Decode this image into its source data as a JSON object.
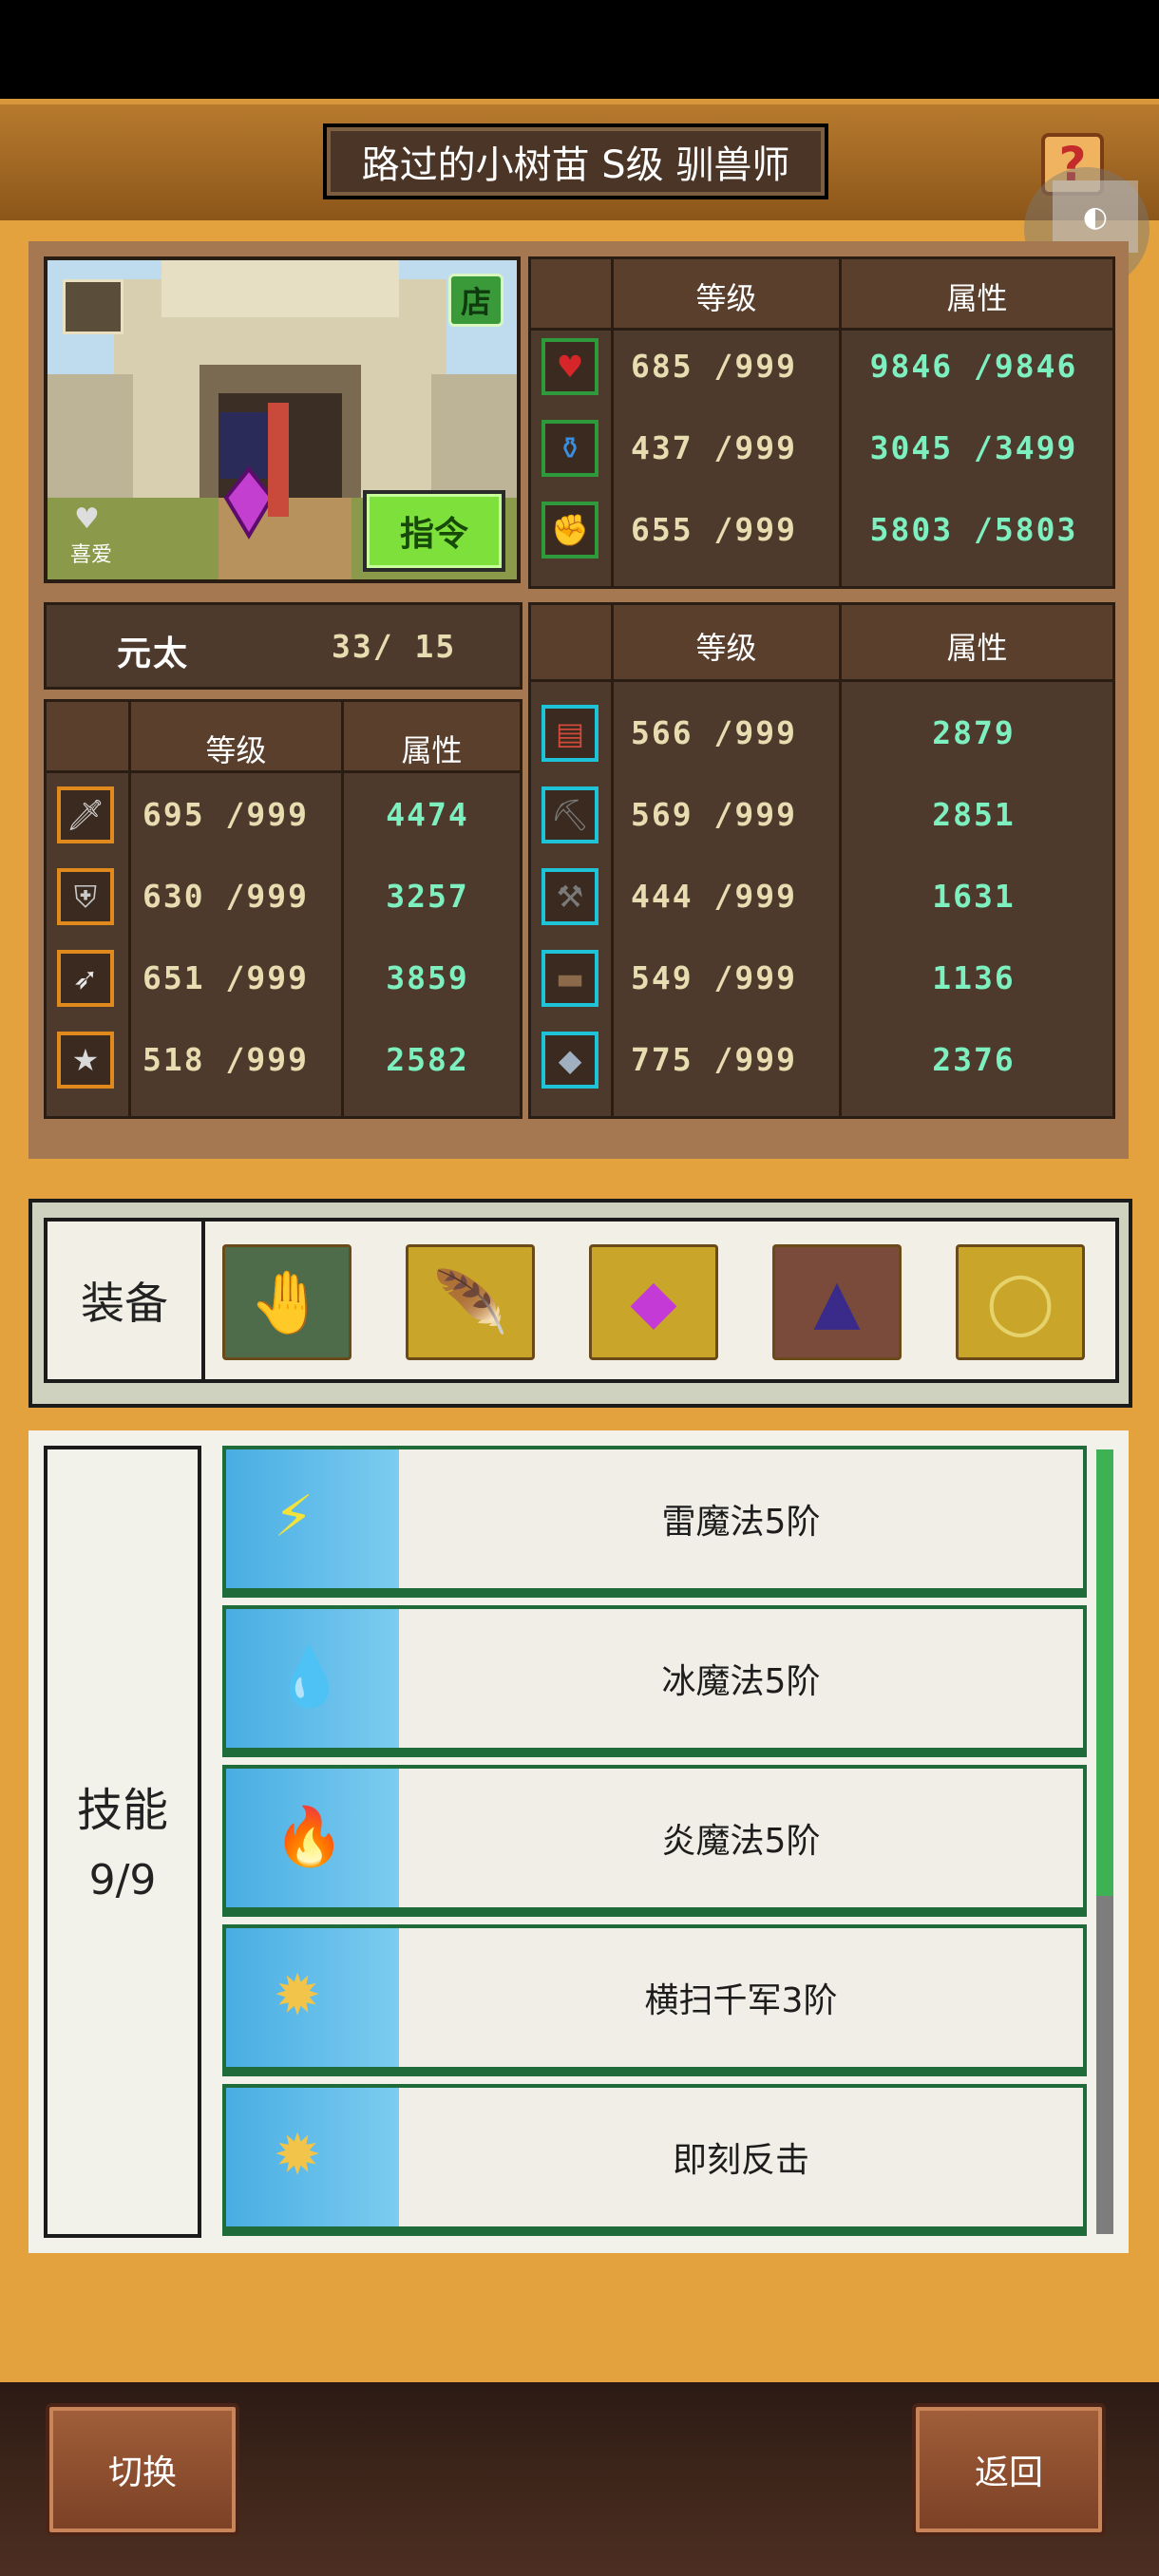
{
  "header": {
    "title": "路过的小树苗 S级 驯兽师",
    "help_label": "?",
    "contrast_label": "◐"
  },
  "portrait": {
    "shop_label": "店",
    "like_label": "喜爱",
    "command_label": "指令"
  },
  "vitals": {
    "col_level": "等级",
    "col_attr": "属性",
    "rows": [
      {
        "icon": "heart-icon",
        "level": "685 /999",
        "attr": "9846 /9846"
      },
      {
        "icon": "potion-icon",
        "level": "437 /999",
        "attr": "3045 /3499"
      },
      {
        "icon": "strength-icon",
        "level": "655 /999",
        "attr": "5803 /5803"
      }
    ]
  },
  "class_row": {
    "name": "元太",
    "count": "33/ 15"
  },
  "combat": {
    "col_level": "等级",
    "col_attr": "属性",
    "rows": [
      {
        "icon": "sword-icon",
        "level": "695 /999",
        "attr": "4474"
      },
      {
        "icon": "shield-icon",
        "level": "630 /999",
        "attr": "3257"
      },
      {
        "icon": "bow-icon",
        "level": "651 /999",
        "attr": "3859"
      },
      {
        "icon": "star-icon",
        "level": "518 /999",
        "attr": "2582"
      }
    ]
  },
  "crafting": {
    "col_level": "等级",
    "col_attr": "属性",
    "rows": [
      {
        "icon": "book-icon",
        "level": "566 /999",
        "attr": "2879"
      },
      {
        "icon": "pickaxe-icon",
        "level": "569 /999",
        "attr": "2851"
      },
      {
        "icon": "shovel-icon",
        "level": "444 /999",
        "attr": "1631"
      },
      {
        "icon": "anvil-icon",
        "level": "549 /999",
        "attr": "1136"
      },
      {
        "icon": "whetstone-icon",
        "level": "775 /999",
        "attr": "2376"
      }
    ]
  },
  "equipment": {
    "label": "装备",
    "slots": [
      {
        "icon": "gauntlet-icon",
        "bg": "#4e6b4a"
      },
      {
        "icon": "feather-blade-icon",
        "bg": "#c9a52a"
      },
      {
        "icon": "purple-gem-icon",
        "bg": "#c9a52a"
      },
      {
        "icon": "dark-hood-icon",
        "bg": "#7a4a3a"
      },
      {
        "icon": "necklace-icon",
        "bg": "#c9a52a"
      }
    ]
  },
  "skills": {
    "label": "技能",
    "count": "9/9",
    "items": [
      {
        "icon": "thunder-staff-icon",
        "name": "雷魔法5阶"
      },
      {
        "icon": "ice-staff-icon",
        "name": "冰魔法5阶"
      },
      {
        "icon": "fire-staff-icon",
        "name": "炎魔法5阶"
      },
      {
        "icon": "sweep-icon",
        "name": "横扫千军3阶"
      },
      {
        "icon": "counter-icon",
        "name": "即刻反击"
      }
    ]
  },
  "bottom": {
    "switch_label": "切换",
    "back_label": "返回"
  }
}
